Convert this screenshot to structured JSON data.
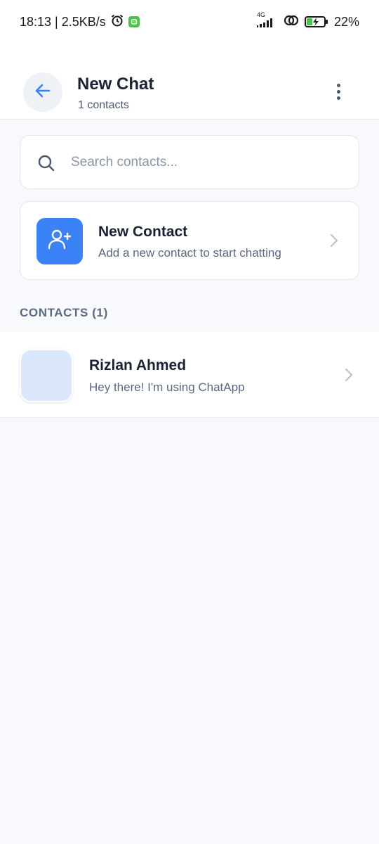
{
  "status_bar": {
    "time_speed": "18:13 | 2.5KB/s",
    "network": "4G",
    "battery": "22%",
    "icons": [
      "alarm-icon",
      "app-notification-icon",
      "signal-icon",
      "hotspot-icon",
      "battery-charging-icon"
    ]
  },
  "header": {
    "title": "New Chat",
    "subtitle": "1 contacts",
    "back_icon": "arrow-left-icon",
    "menu_icon": "more-vertical-icon"
  },
  "search": {
    "placeholder": "Search contacts...",
    "value": ""
  },
  "new_contact": {
    "title": "New Contact",
    "subtitle": "Add a new contact to start chatting",
    "icon": "add-user-icon"
  },
  "contacts_section": {
    "label": "CONTACTS (1)"
  },
  "contacts": [
    {
      "name": "Rizlan Ahmed",
      "status": "Hey there! I'm using ChatApp"
    }
  ],
  "colors": {
    "accent": "#3b82f6",
    "background": "#f7f9fc",
    "avatar_placeholder": "#dbe8fb"
  }
}
